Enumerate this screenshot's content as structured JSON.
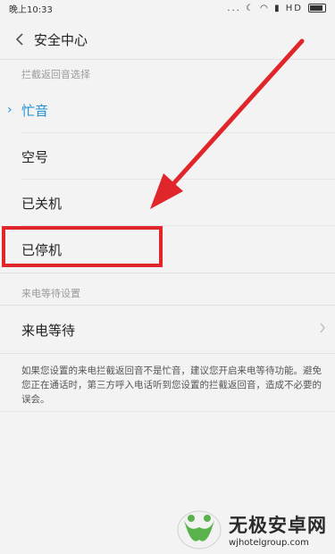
{
  "status_bar": {
    "time": "晚上10:33",
    "icons": "... ☾ ◠ ▮ HD"
  },
  "header": {
    "title": "安全中心"
  },
  "sections": [
    {
      "label": "拦截返回音选择",
      "options": [
        "忙音",
        "空号",
        "已关机",
        "已停机"
      ],
      "selected": "忙音"
    },
    {
      "label": "来电等待设置",
      "items": [
        "来电等待"
      ]
    }
  ],
  "note": "如果您设置的来电拦截返回音不是忙音，建议您开启来电等待功能。避免您正在通话时，第三方呼入电话听到您设置的拦截返回音，造成不必要的误会。",
  "icons": {
    "back": "chevron-left-icon",
    "selected_marker": "chevron-right-icon",
    "row_arrow": "chevron-right-icon"
  },
  "annotation": {
    "arrow_color": "#e0252b",
    "box_color": "#e0252b",
    "highlighted_option": "已停机"
  },
  "watermark": {
    "name": "无极安卓网",
    "url": "wjhotelgroup.com"
  }
}
